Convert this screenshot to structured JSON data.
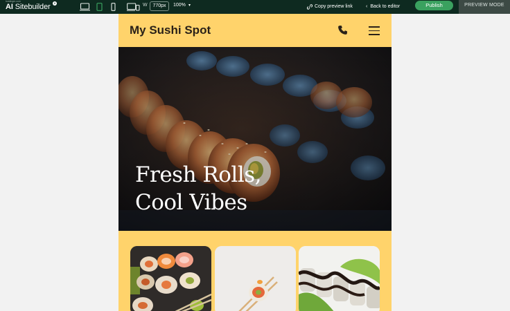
{
  "app": {
    "brand_small": "hostinger.com",
    "brand_prefix": "AI",
    "brand_name": "Sitebuilder",
    "brand_badge": "2"
  },
  "toolbar": {
    "devices": [
      "desktop-icon",
      "tablet-icon",
      "mobile-icon",
      "fit-width-icon"
    ],
    "active_device": "tablet",
    "width_label": "W",
    "width_value": "770px",
    "zoom": "100%",
    "copy_preview_link": "Copy preview link",
    "back_to_editor": "Back to editor",
    "publish": "Publish",
    "preview_mode": "PREVIEW MODE",
    "accent": "#3aa15f",
    "bar_color": "#0e2a20"
  },
  "site": {
    "title": "My Sushi Spot",
    "background": "#ffd36b",
    "hero_line_1": "Fresh Rolls,",
    "hero_line_2": "Cool Vibes",
    "gallery": [
      {
        "image": "sushi-platter"
      },
      {
        "image": "sushi-roll-chopsticks"
      },
      {
        "image": "sauce-drizzled-rolls"
      }
    ]
  }
}
